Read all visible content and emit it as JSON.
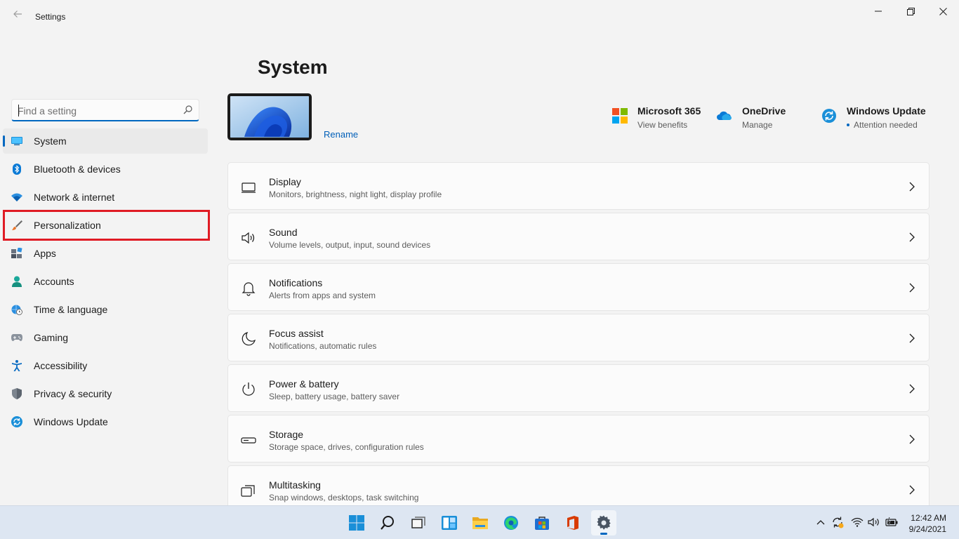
{
  "window": {
    "app_title": "Settings",
    "page_title": "System"
  },
  "search": {
    "placeholder": "Find a setting",
    "value": ""
  },
  "sidebar": {
    "items": [
      {
        "label": "System",
        "icon": "system-icon",
        "selected": true
      },
      {
        "label": "Bluetooth & devices",
        "icon": "bluetooth-icon"
      },
      {
        "label": "Network & internet",
        "icon": "wifi-icon"
      },
      {
        "label": "Personalization",
        "icon": "brush-icon",
        "highlighted": true
      },
      {
        "label": "Apps",
        "icon": "apps-icon"
      },
      {
        "label": "Accounts",
        "icon": "person-icon"
      },
      {
        "label": "Time & language",
        "icon": "globe-clock-icon"
      },
      {
        "label": "Gaming",
        "icon": "gamepad-icon"
      },
      {
        "label": "Accessibility",
        "icon": "accessibility-icon"
      },
      {
        "label": "Privacy & security",
        "icon": "shield-icon"
      },
      {
        "label": "Windows Update",
        "icon": "update-icon"
      }
    ]
  },
  "device": {
    "rename_label": "Rename"
  },
  "quick_links": [
    {
      "title": "Microsoft 365",
      "subtitle": "View benefits",
      "icon": "microsoft-logo-icon"
    },
    {
      "title": "OneDrive",
      "subtitle": "Manage",
      "icon": "onedrive-cloud-icon"
    },
    {
      "title": "Windows Update",
      "subtitle": "Attention needed",
      "icon": "update-icon"
    }
  ],
  "cards": [
    {
      "title": "Display",
      "subtitle": "Monitors, brightness, night light, display profile",
      "icon": "monitor-icon"
    },
    {
      "title": "Sound",
      "subtitle": "Volume levels, output, input, sound devices",
      "icon": "speaker-icon"
    },
    {
      "title": "Notifications",
      "subtitle": "Alerts from apps and system",
      "icon": "bell-icon"
    },
    {
      "title": "Focus assist",
      "subtitle": "Notifications, automatic rules",
      "icon": "moon-icon"
    },
    {
      "title": "Power & battery",
      "subtitle": "Sleep, battery usage, battery saver",
      "icon": "power-icon"
    },
    {
      "title": "Storage",
      "subtitle": "Storage space, drives, configuration rules",
      "icon": "drive-icon"
    },
    {
      "title": "Multitasking",
      "subtitle": "Snap windows, desktops, task switching",
      "icon": "multitask-icon"
    }
  ],
  "taskbar": {
    "time": "12:42 AM",
    "date": "9/24/2021",
    "apps": [
      "start-icon",
      "search-icon",
      "task-view-icon",
      "widgets-icon",
      "file-explorer-icon",
      "edge-icon",
      "store-icon",
      "office-icon",
      "settings-gear-icon"
    ]
  },
  "colors": {
    "accent": "#0067c0",
    "highlight_box": "#e01b24",
    "background": "#f3f3f3",
    "card": "#fbfbfb"
  }
}
